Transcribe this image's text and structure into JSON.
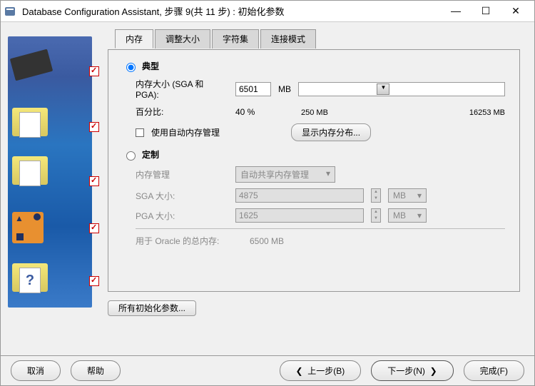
{
  "titlebar": {
    "title": "Database Configuration Assistant, 步骤 9(共 11 步) : 初始化参数"
  },
  "tabs": {
    "memory": "内存",
    "size": "调整大小",
    "charset": "字符集",
    "connmode": "连接模式"
  },
  "memory": {
    "typical_label": "典型",
    "mem_size_label": "内存大小 (SGA 和 PGA):",
    "mem_size_value": "6501",
    "mem_size_unit": "MB",
    "slider_min": "250 MB",
    "slider_max": "16253 MB",
    "percent_label": "百分比:",
    "percent_value": "40 %",
    "auto_mem_label": "使用自动内存管理",
    "show_dist_button": "显示内存分布...",
    "custom_label": "定制",
    "mem_mgmt_label": "内存管理",
    "mem_mgmt_value": "自动共享内存管理",
    "sga_label": "SGA 大小:",
    "sga_value": "4875",
    "pga_label": "PGA 大小:",
    "pga_value": "1625",
    "unit_mb": "MB",
    "total_label": "用于 Oracle 的总内存:",
    "total_value": "6500 MB"
  },
  "buttons": {
    "all_params": "所有初始化参数...",
    "cancel": "取消",
    "help": "帮助",
    "back": "上一步(B)",
    "next": "下一步(N)",
    "finish": "完成(F)"
  }
}
